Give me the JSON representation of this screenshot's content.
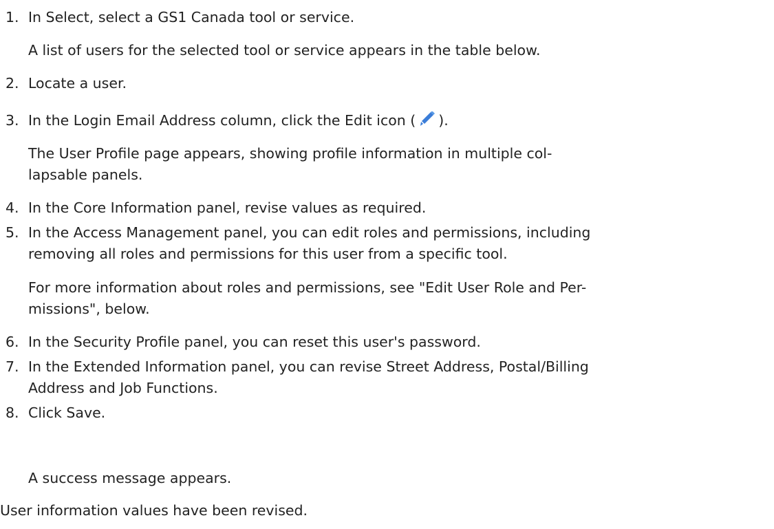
{
  "steps": [
    {
      "number": "1.",
      "lines": [
        "In Select, select a GS1 Canada tool or service."
      ],
      "result": [
        "A list of users for the selected tool or service appears in the table below."
      ]
    },
    {
      "number": "2.",
      "lines": [
        "Locate a user."
      ]
    },
    {
      "number": "3.",
      "line_before_icon": "In the Login Email Address column, click the Edit icon (",
      "line_after_icon": ").",
      "icon": "pencil-edit-icon",
      "icon_color": "#3b7dd8",
      "result": [
        "The User Profile page appears, showing profile information in multiple col-",
        "lapsable panels."
      ]
    },
    {
      "number": "4.",
      "lines": [
        "In the Core Information panel, revise values as required."
      ]
    },
    {
      "number": "5.",
      "lines": [
        "In the Access Management panel, you can edit roles and permissions, including",
        "removing all roles and permissions for this user from a specific tool."
      ],
      "result": [
        "For more information about roles and permissions, see \"Edit User Role and Per-",
        "missions\", below."
      ]
    },
    {
      "number": "6.",
      "lines": [
        "In the Security Profile panel, you can reset this user's password."
      ]
    },
    {
      "number": "7.",
      "lines": [
        "In the Extended Information panel, you can revise Street Address, Postal/Billing",
        "Address and Job Functions."
      ]
    },
    {
      "number": "8.",
      "lines": [
        "Click Save."
      ],
      "result": [
        "A success message appears."
      ]
    }
  ],
  "closing": "User information values have been revised."
}
